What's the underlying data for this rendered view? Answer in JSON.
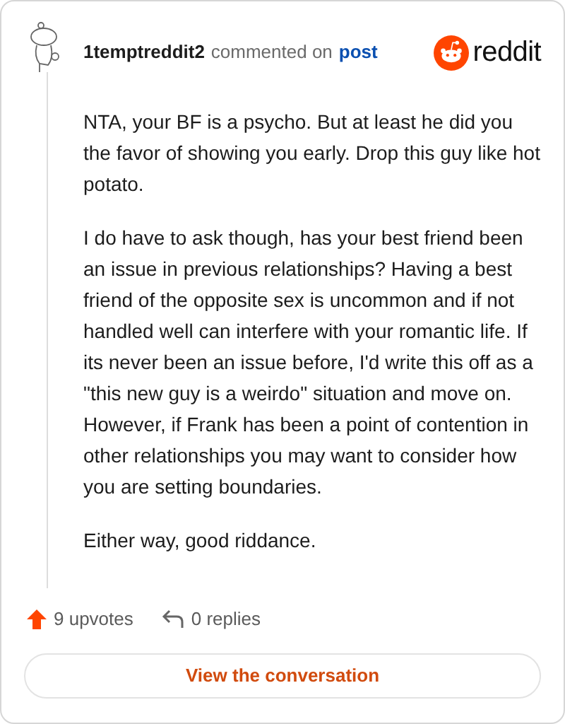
{
  "comment": {
    "author": "1temptreddit2",
    "action": "commented on",
    "link": "post",
    "brand": "reddit",
    "paragraphs": [
      "NTA, your BF is a psycho. But at least he did you the favor of showing you early. Drop this guy like hot potato.",
      "I do have to ask though, has your best friend been an issue in previous relationships? Having a best friend of the opposite sex is uncommon and if not handled well can interfere with your romantic life. If its never been an issue before, I'd write this off as a \"this new guy is a weirdo\" situation and move on. However, if Frank has been a point of contention in other relationships you may want to consider how you are setting boundaries.",
      "Either way, good riddance."
    ],
    "upvotes": "9 upvotes",
    "replies": "0 replies"
  },
  "button": "View the conversation"
}
